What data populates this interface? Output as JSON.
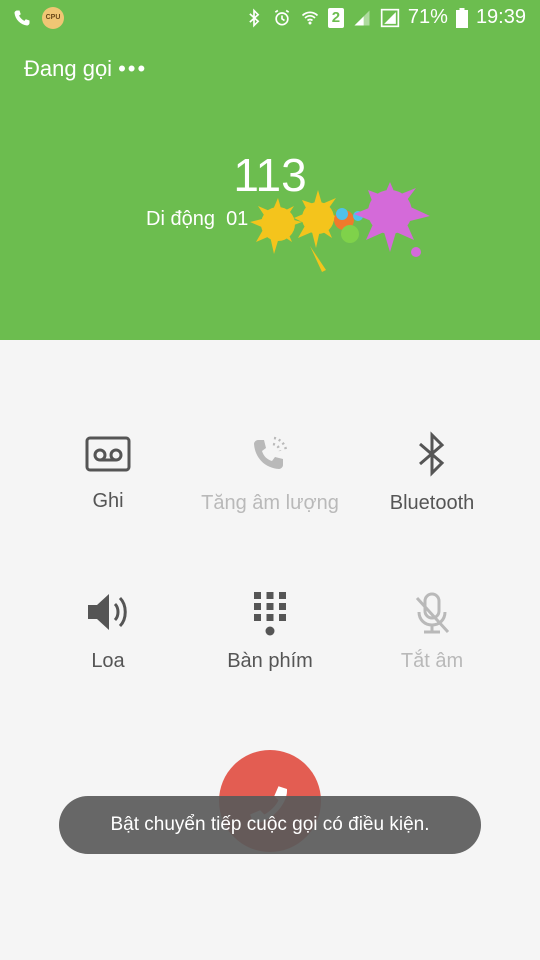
{
  "status_bar": {
    "battery_percent": "71%",
    "time": "19:39",
    "sim_badge": "2",
    "cpu_label": "CPU"
  },
  "call": {
    "status": "Đang gọi",
    "status_dots": "•••",
    "number": "113",
    "sub_label": "Di động",
    "sub_number": "01"
  },
  "buttons": {
    "record": "Ghi",
    "volume_boost": "Tăng âm lượng",
    "bluetooth": "Bluetooth",
    "speaker": "Loa",
    "keypad": "Bàn phím",
    "mute": "Tắt âm"
  },
  "toast": "Bật chuyển tiếp cuộc gọi có điều kiện.",
  "colors": {
    "header_bg": "#6cbd4f",
    "end_call": "#e35d52",
    "toast_bg": "#5a5a5a"
  }
}
